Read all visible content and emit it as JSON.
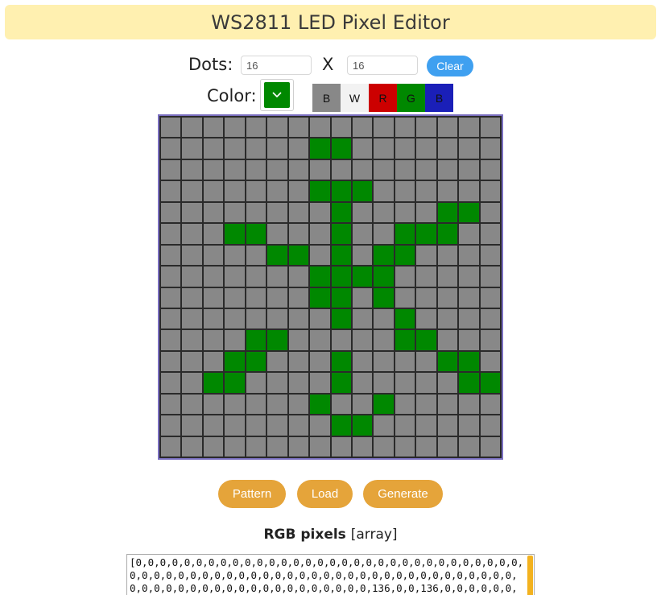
{
  "header": {
    "title": "WS2811 LED Pixel Editor"
  },
  "dots": {
    "label": "Dots:",
    "width_value": "16",
    "separator": "X",
    "height_value": "16",
    "clear_label": "Clear"
  },
  "color": {
    "label": "Color:",
    "selected": "#008800",
    "picker_icon": "chevron-down-icon",
    "swatches": [
      {
        "label": "B",
        "color": "#888888"
      },
      {
        "label": "W",
        "color": "#f2f2f2"
      },
      {
        "label": "R",
        "color": "#cc0000"
      },
      {
        "label": "G",
        "color": "#008800"
      },
      {
        "label": "B",
        "color": "#1a1fb8"
      }
    ]
  },
  "grid": {
    "rows": 16,
    "cols": 16,
    "off_color": "#888888",
    "on_color": "#008800",
    "pixels": [
      "0000000000000000",
      "0000000110000000",
      "0000000000000000",
      "0000000111000000",
      "0000000010000110",
      "0001100010011100",
      "0000011010110000",
      "0000000111100000",
      "0000000110100000",
      "0000000010010000",
      "0000110000011000",
      "0001100010000110",
      "0011000010000011",
      "0000000100100000",
      "0000000011000000",
      "0000000000000000"
    ]
  },
  "actions": {
    "pattern_label": "Pattern",
    "load_label": "Load",
    "generate_label": "Generate"
  },
  "output": {
    "heading": "RGB pixels",
    "heading_suffix": "[array]",
    "text": "[0,0,0,0,0,0,0,0,0,0,0,0,0,0,0,0,0,0,0,0,0,0,0,0,0,0,0,0,0,0,0,0,0,0,0,0,0,0,0,0,0,0,0,0,0,0,0,0,0,0,0,0,0,0,0,0,0,0,0,0,0,0,0,0,0,0,0,0,0,0,0,0,0,0,0,0,0,0,0,0,0,0,0,0,136,0,0,136,0,0,0,0,0,0,0,0,0,0,0,0,0,0,0,0,0,0,0,0,"
  }
}
